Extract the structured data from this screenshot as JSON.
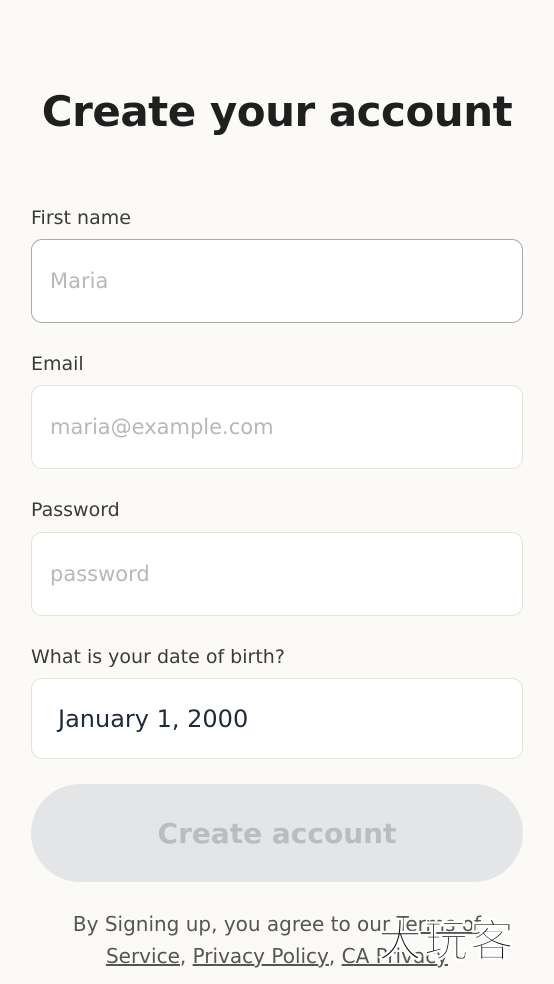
{
  "page": {
    "title": "Create your account"
  },
  "form": {
    "first_name": {
      "label": "First name",
      "placeholder": "Maria",
      "value": ""
    },
    "email": {
      "label": "Email",
      "placeholder": "maria@example.com",
      "value": ""
    },
    "password": {
      "label": "Password",
      "placeholder": "password",
      "value": ""
    },
    "dob": {
      "label": "What is your date of birth?",
      "value": "January 1, 2000"
    },
    "submit_label": "Create account"
  },
  "terms": {
    "prefix": "By Signing up, you agree to our ",
    "terms_link": "Terms of Service",
    "sep1": ", ",
    "privacy_link": "Privacy Policy",
    "sep2": ", ",
    "ca_privacy_link": "CA Privacy"
  },
  "watermark": {
    "text": "大玩客"
  },
  "colors": {
    "background": "#fbfaf7",
    "button_disabled_bg": "#e3e5e7",
    "button_disabled_text": "#b9bcc0"
  }
}
